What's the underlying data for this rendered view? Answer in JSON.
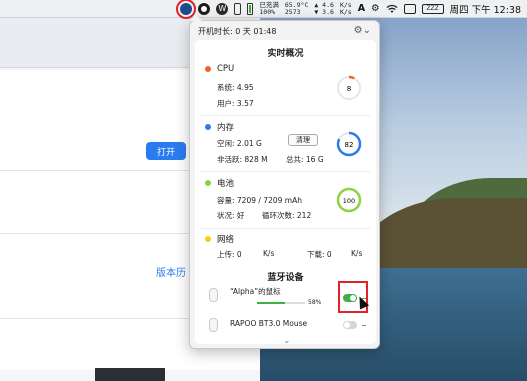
{
  "menubar": {
    "netstat_top": "已充满",
    "netstat_bottom": "100%",
    "temp_top": "65.9°C",
    "temp_bottom": "2573",
    "up_rate": "▲ 4.6",
    "down_rate": "▼ 3.6",
    "up_unit": "K/s",
    "down_unit": "K/s",
    "datetime": "周四 下午 12:38",
    "battery_label": "ZZZ"
  },
  "background_app": {
    "open_button": "打开",
    "version_link": "版本历"
  },
  "popover": {
    "uptime": "开机时长: 0 天 01:48",
    "realtime_title": "实时概况",
    "cpu": {
      "title": "CPU",
      "system": "系统: 4.95",
      "user": "用户: 3.57",
      "gauge_value": "8",
      "gauge_percent": 8,
      "color": "#f0622a"
    },
    "memory": {
      "title": "内存",
      "free": "空闲: 2.01 G",
      "clean_button": "清理",
      "inactive": "非活跃: 828   M",
      "total": "总共: 16 G",
      "gauge_value": "82",
      "gauge_percent": 82,
      "color": "#2a7bf0"
    },
    "battery": {
      "title": "电池",
      "capacity": "容量: 7209 / 7209 mAh",
      "status": "状况: 好",
      "cycles": "循环次数: 212",
      "gauge_value": "100",
      "gauge_percent": 100,
      "color": "#8fd13f"
    },
    "network": {
      "title": "网络",
      "upload_label": "上传: 0",
      "upload_unit": "K/s",
      "download_label": "下载: 0",
      "download_unit": "K/s",
      "color": "#f5d000"
    },
    "bluetooth": {
      "title": "蓝牙设备",
      "devices": [
        {
          "name": "“Alpha”的鼠标",
          "battery": "58%",
          "battery_fraction": 0.58,
          "connected": true
        },
        {
          "name": "RAPOO BT3.0 Mouse",
          "connected": false
        }
      ]
    }
  }
}
